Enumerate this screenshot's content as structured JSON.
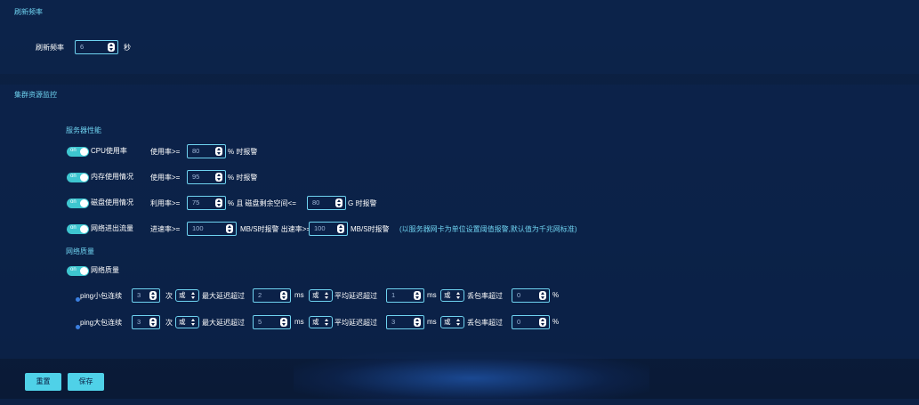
{
  "refresh": {
    "section_title": "刷新频率",
    "label": "刷新频率",
    "value": "6",
    "unit": "秒"
  },
  "cluster": {
    "section_title": "集群资源监控",
    "server_perf_title": "服务器性能",
    "toggle_text": "on",
    "cpu": {
      "name": "CPU使用率",
      "prefix": "使用率>=",
      "value": "80",
      "suffix": "% 时报警"
    },
    "mem": {
      "name": "内存使用情况",
      "prefix": "使用率>=",
      "value": "95",
      "suffix": "% 时报警"
    },
    "disk": {
      "name": "磁盘使用情况",
      "prefix": "利用率>=",
      "value": "75",
      "mid": "% 且 磁盘剩余空间<=",
      "value2": "80",
      "suffix": "G 时报警"
    },
    "net": {
      "name": "网络进出流量",
      "in_prefix": "进速率>=",
      "in_value": "100",
      "mid": "MB/S时报警 出速率>=",
      "out_value": "100",
      "suffix": "MB/S时报警",
      "note": "(以服务器网卡为单位设置阈值报警,默认值为千兆网标准)"
    },
    "net_quality_title": "网络质量",
    "net_quality_toggle_label": "网络质量",
    "ping_small": {
      "label": "ping小包连续",
      "count": "3",
      "count_unit": "次",
      "op1": "或",
      "max_label": "最大延迟超过",
      "max_value": "2",
      "ms1": "ms",
      "op2": "或",
      "avg_label": "平均延迟超过",
      "avg_value": "1",
      "ms2": "ms",
      "op3": "或",
      "loss_label": "丢包率超过",
      "loss_value": "0",
      "pct": "%"
    },
    "ping_large": {
      "label": "ping大包连续",
      "count": "3",
      "count_unit": "次",
      "op1": "或",
      "max_label": "最大延迟超过",
      "max_value": "5",
      "ms1": "ms",
      "op2": "或",
      "avg_label": "平均延迟超过",
      "avg_value": "3",
      "ms2": "ms",
      "op3": "或",
      "loss_label": "丢包率超过",
      "loss_value": "0",
      "pct": "%"
    }
  },
  "actions": {
    "reset_label": "重置",
    "save_label": "保存"
  }
}
